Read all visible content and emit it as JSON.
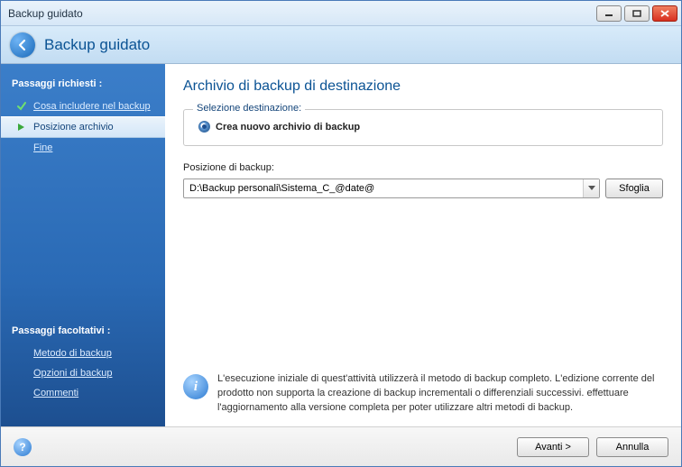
{
  "window": {
    "title": "Backup guidato"
  },
  "header": {
    "title": "Backup guidato"
  },
  "sidebar": {
    "required_heading": "Passaggi richiesti :",
    "optional_heading": "Passaggi facoltativi :",
    "steps_required": [
      {
        "label": "Cosa includere nel backup",
        "state": "done"
      },
      {
        "label": "Posizione archivio",
        "state": "current"
      },
      {
        "label": "Fine",
        "state": "pending"
      }
    ],
    "steps_optional": [
      {
        "label": "Metodo di backup"
      },
      {
        "label": "Opzioni di backup"
      },
      {
        "label": "Commenti"
      }
    ]
  },
  "main": {
    "page_title": "Archivio di backup di destinazione",
    "groupbox_legend": "Selezione destinazione:",
    "radio_create_label": "Crea nuovo archivio di backup",
    "location_label": "Posizione di backup:",
    "location_value": "D:\\Backup personali\\Sistema_C_@date@",
    "browse_label": "Sfoglia",
    "info_text": "L'esecuzione iniziale di quest'attività utilizzerà il metodo di backup completo. L'edizione corrente del prodotto non supporta la creazione di backup incrementali o differenziali successivi. effettuare l'aggiornamento alla versione completa per poter utilizzare altri metodi di backup."
  },
  "footer": {
    "next_label": "Avanti >",
    "cancel_label": "Annulla"
  }
}
